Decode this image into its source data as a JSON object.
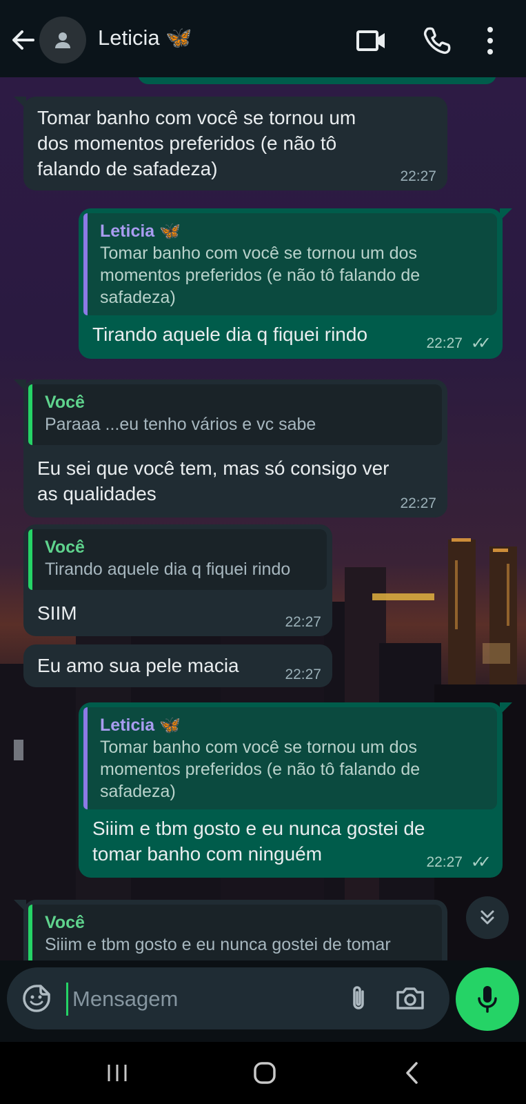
{
  "header": {
    "contact_name": "Leticia 🦋",
    "icons": [
      "back-arrow-icon",
      "avatar-placeholder-icon",
      "video-call-icon",
      "voice-call-icon",
      "more-options-icon"
    ]
  },
  "messages": [
    {
      "direction": "incoming",
      "lines": [
        "Tomar banho com você se tornou um",
        "dos momentos preferidos (e não tô",
        "falando de safadeza)"
      ],
      "time": "22:27"
    },
    {
      "direction": "outgoing",
      "quote": {
        "author": "Leticia 🦋",
        "lines": [
          "Tomar banho com você se tornou um dos",
          "momentos preferidos (e não tô falando de",
          "safadeza)"
        ]
      },
      "text": "Tirando aquele dia q fiquei rindo",
      "time": "22:27",
      "status": "read"
    },
    {
      "direction": "incoming",
      "quote": {
        "author": "Você",
        "lines": [
          "Paraaa ...eu tenho vários e vc sabe"
        ]
      },
      "lines": [
        "Eu sei que você tem, mas só consigo ver",
        "as qualidades"
      ],
      "time": "22:27"
    },
    {
      "direction": "incoming",
      "quote": {
        "author": "Você",
        "lines": [
          "Tirando aquele dia q fiquei rindo"
        ]
      },
      "text": "SIIM",
      "time": "22:27"
    },
    {
      "direction": "incoming",
      "text": "Eu amo sua pele macia",
      "time": "22:27"
    },
    {
      "direction": "outgoing",
      "quote": {
        "author": "Leticia 🦋",
        "lines": [
          "Tomar banho com você se tornou um dos",
          "momentos preferidos (e não tô falando de",
          "safadeza)"
        ]
      },
      "lines": [
        "Siiim e tbm gosto e eu nunca gostei de",
        "tomar banho com ninguém"
      ],
      "time": "22:27",
      "status": "read"
    },
    {
      "direction": "incoming",
      "quote": {
        "author": "Você",
        "lines": [
          "Siiim e tbm gosto e eu nunca gostei de tomar"
        ]
      }
    }
  ],
  "ticks": "✓✓",
  "input": {
    "placeholder": "Mensagem"
  },
  "colors": {
    "incoming_bubble": "#202c33",
    "outgoing_bubble": "#005c4b",
    "accent_green": "#25d366",
    "header_bg": "#0b141a"
  }
}
